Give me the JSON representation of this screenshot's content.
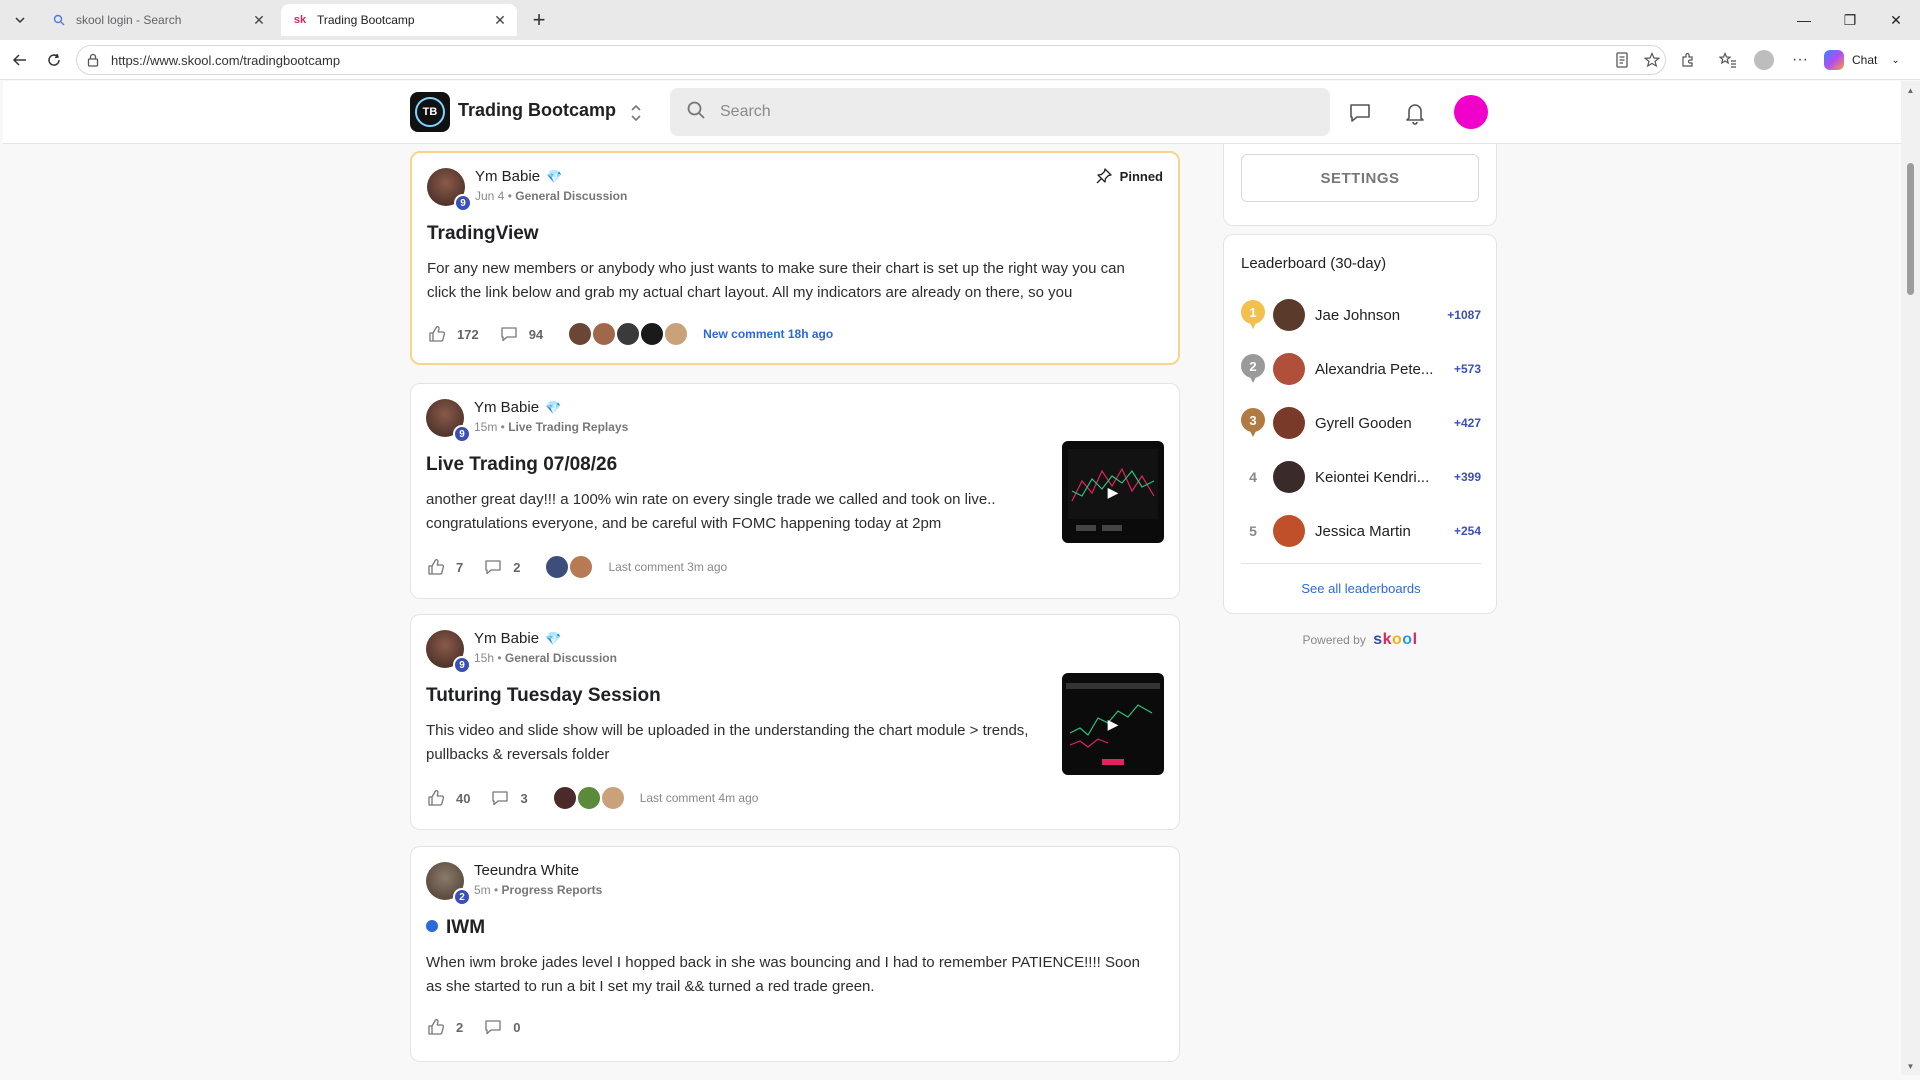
{
  "browser": {
    "tabs": [
      {
        "title": "skool login - Search",
        "favicon": "search-icon"
      },
      {
        "title": "Trading Bootcamp",
        "favicon_text": "sk"
      }
    ],
    "url": "https://www.skool.com/tradingbootcamp",
    "chat_label": "Chat"
  },
  "header": {
    "logo_text": "TB",
    "group_name": "Trading Bootcamp",
    "search_placeholder": "Search"
  },
  "posts": [
    {
      "author": "Ym Babie",
      "level": "9",
      "time": "Jun 4",
      "category": "General Discussion",
      "title": "TradingView",
      "body": "For any new members or anybody who just wants to make sure their chart is set up the right way you can click the link below and grab my actual chart layout. All my indicators are already on there, so you",
      "likes": "172",
      "comments": "94",
      "comment_status": "New comment 18h ago",
      "pinned_label": "Pinned"
    },
    {
      "author": "Ym Babie",
      "level": "9",
      "time": "15m",
      "category": "Live Trading Replays",
      "title": "Live Trading 07/08/26",
      "body": "another great day!!! a 100% win rate on every single trade we called and took on live.. congratulations everyone, and be careful with FOMC happening today at 2pm",
      "likes": "7",
      "comments": "2",
      "comment_status": "Last comment 3m ago"
    },
    {
      "author": "Ym Babie",
      "level": "9",
      "time": "15h",
      "category": "General Discussion",
      "title": "Tuturing Tuesday Session",
      "body": "This video and slide show will be uploaded in the understanding the chart module > trends, pullbacks & reversals folder",
      "likes": "40",
      "comments": "3",
      "comment_status": "Last comment 4m ago"
    },
    {
      "author": "Teeundra White",
      "level": "2",
      "time": "5m",
      "category": "Progress Reports",
      "title": "IWM",
      "body": "When iwm broke jades level I hopped back in she was bouncing and I had to remember PATIENCE!!!! Soon as she started to run a bit I set my trail && turned a red trade green.",
      "likes": "2",
      "comments": "0"
    }
  ],
  "sidebar": {
    "settings_label": "SETTINGS",
    "leaderboard_title": "Leaderboard (30-day)",
    "leaders": [
      {
        "rank": "1",
        "name": "Jae Johnson",
        "points": "+1087"
      },
      {
        "rank": "2",
        "name": "Alexandria Pete...",
        "points": "+573"
      },
      {
        "rank": "3",
        "name": "Gyrell Gooden",
        "points": "+427"
      },
      {
        "rank": "4",
        "name": "Keiontei Kendri...",
        "points": "+399"
      },
      {
        "rank": "5",
        "name": "Jessica Martin",
        "points": "+254"
      }
    ],
    "see_all": "See all leaderboards",
    "powered_by": "Powered by",
    "brand": "skool"
  },
  "colors": {
    "accent_blue": "#2a6ad8",
    "level_badge": "#3b4fb8",
    "gold": "#f3c14b",
    "silver": "#9a9a9a",
    "bronze": "#b07a43",
    "user_avatar": "#f000c8",
    "pinned_border": "#f6d58a"
  }
}
